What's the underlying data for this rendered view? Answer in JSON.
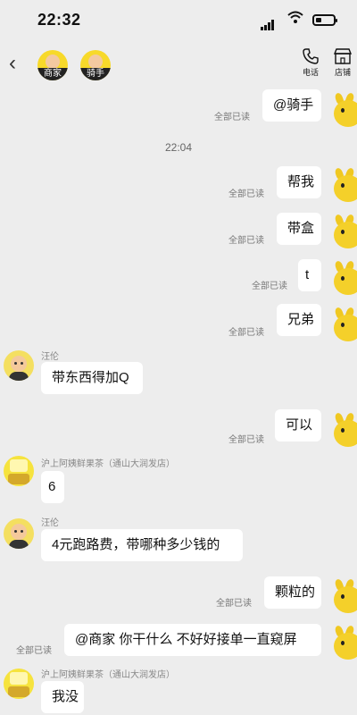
{
  "status": {
    "time": "22:32"
  },
  "header": {
    "participants": [
      {
        "label": "商家",
        "icon": "merchant-avatar"
      },
      {
        "label": "骑手",
        "icon": "rider-avatar"
      }
    ],
    "actions": [
      {
        "label": "电话",
        "icon": "phone-icon"
      },
      {
        "label": "店铺",
        "icon": "store-icon"
      }
    ]
  },
  "messages": {
    "m1": {
      "text": "@骑手",
      "read": "全部已读"
    },
    "timestamp": "22:04",
    "m2": {
      "text": "帮我",
      "read": "全部已读"
    },
    "m3": {
      "text": "带盒",
      "read": "全部已读"
    },
    "m4": {
      "text": "t",
      "read": "全部已读"
    },
    "m5": {
      "text": "兄弟",
      "read": "全部已读"
    },
    "m6": {
      "sender": "汪伦",
      "text": "带东西得加Q"
    },
    "m7": {
      "text": "可以",
      "read": "全部已读"
    },
    "m8": {
      "sender": "沪上阿姨鲜果茶（通山大润发店）",
      "text": "6"
    },
    "m9": {
      "sender": "汪伦",
      "text": "4元跑路费，带哪种多少钱的"
    },
    "m10": {
      "text": "颗粒的",
      "read": "全部已读"
    },
    "m11": {
      "text": "@商家 你干什么 不好好接单一直窥屏",
      "read": "全部已读"
    },
    "m12": {
      "sender": "沪上阿姨鲜果茶（通山大润发店）",
      "text": "我没"
    }
  }
}
